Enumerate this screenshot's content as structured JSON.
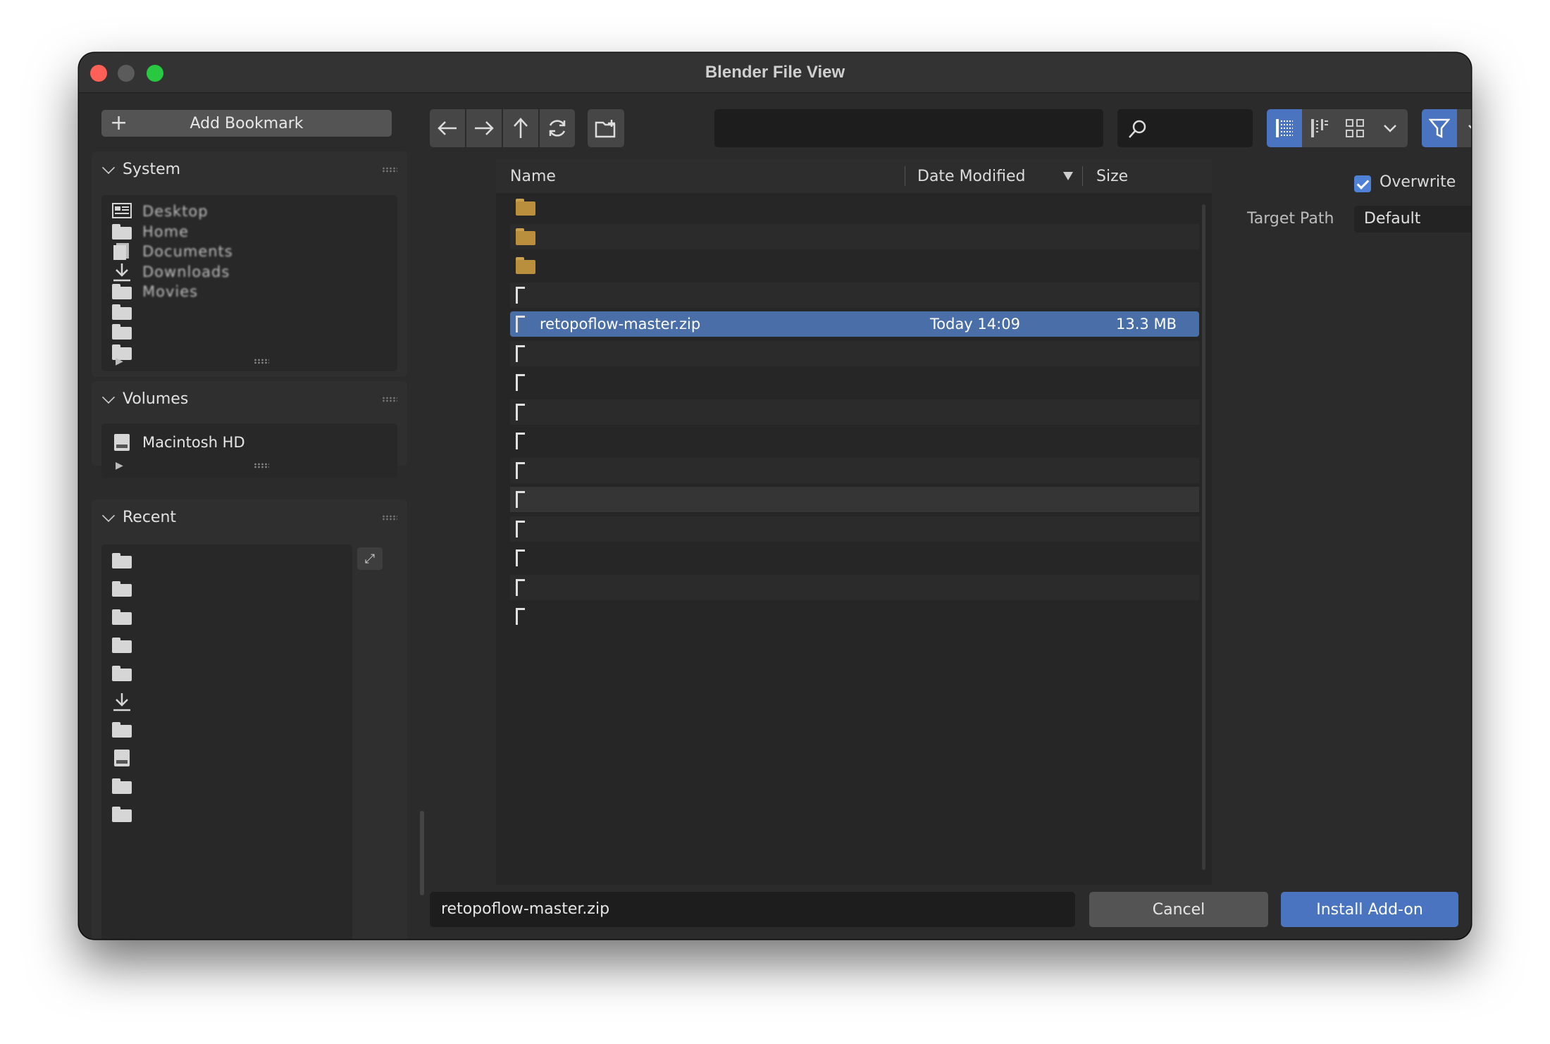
{
  "window": {
    "title": "Blender File View"
  },
  "sidebar": {
    "add_bookmark_label": "Add Bookmark",
    "system": {
      "title": "System",
      "items": [
        {
          "label": "Desktop",
          "icon": "desktop-icon"
        },
        {
          "label": "Home",
          "icon": "folder-icon"
        },
        {
          "label": "Documents",
          "icon": "documents-icon"
        },
        {
          "label": "Downloads",
          "icon": "download-icon"
        },
        {
          "label": "Movies",
          "icon": "folder-icon"
        },
        {
          "label": "",
          "icon": "folder-icon"
        },
        {
          "label": "",
          "icon": "folder-icon"
        },
        {
          "label": "",
          "icon": "folder-icon"
        }
      ]
    },
    "volumes": {
      "title": "Volumes",
      "items": [
        {
          "label": "Macintosh HD",
          "icon": "disk-icon"
        }
      ]
    },
    "recent": {
      "title": "Recent",
      "items": [
        {
          "label": "",
          "icon": "folder-icon"
        },
        {
          "label": "",
          "icon": "folder-icon"
        },
        {
          "label": "",
          "icon": "folder-icon"
        },
        {
          "label": "",
          "icon": "folder-icon"
        },
        {
          "label": "",
          "icon": "folder-icon"
        },
        {
          "label": "",
          "icon": "download-icon"
        },
        {
          "label": "",
          "icon": "folder-icon"
        },
        {
          "label": "",
          "icon": "disk-icon"
        },
        {
          "label": "",
          "icon": "folder-icon"
        },
        {
          "label": "",
          "icon": "folder-icon"
        }
      ]
    }
  },
  "toolbar": {
    "path": "",
    "search_placeholder": ""
  },
  "filelist": {
    "columns": {
      "name": "Name",
      "date": "Date Modified",
      "size": "Size"
    },
    "rows": [
      {
        "name": "",
        "date": "",
        "size": "",
        "type": "folder"
      },
      {
        "name": "",
        "date": "",
        "size": "",
        "type": "folder"
      },
      {
        "name": "",
        "date": "",
        "size": "",
        "type": "folder"
      },
      {
        "name": "",
        "date": "",
        "size": "",
        "type": "zip"
      },
      {
        "name": "retopoflow-master.zip",
        "date": "Today 14:09",
        "size": "13.3 MB",
        "type": "zip",
        "selected": true
      },
      {
        "name": "",
        "date": "",
        "size": "",
        "type": "zip"
      },
      {
        "name": "",
        "date": "",
        "size": "",
        "type": "zip"
      },
      {
        "name": "",
        "date": "",
        "size": "",
        "type": "zip"
      },
      {
        "name": "",
        "date": "",
        "size": "",
        "type": "zip"
      },
      {
        "name": "",
        "date": "",
        "size": "",
        "type": "zip"
      },
      {
        "name": "",
        "date": "",
        "size": "",
        "type": "zip",
        "hover": true
      },
      {
        "name": "",
        "date": "",
        "size": "",
        "type": "zip"
      },
      {
        "name": "",
        "date": "",
        "size": "",
        "type": "zip"
      },
      {
        "name": "",
        "date": "",
        "size": "",
        "type": "zip"
      },
      {
        "name": "",
        "date": "",
        "size": "",
        "type": "zip"
      }
    ]
  },
  "options": {
    "overwrite_label": "Overwrite",
    "target_path_label": "Target Path",
    "target_path_value": "Default"
  },
  "footer": {
    "filename": "retopoflow-master.zip",
    "cancel_label": "Cancel",
    "install_label": "Install Add-on"
  },
  "colors": {
    "accent": "#4a74c0",
    "selection": "#4a6ea8",
    "close": "#fe5f57",
    "maximize": "#28c840",
    "folder": "#b98e3c"
  }
}
